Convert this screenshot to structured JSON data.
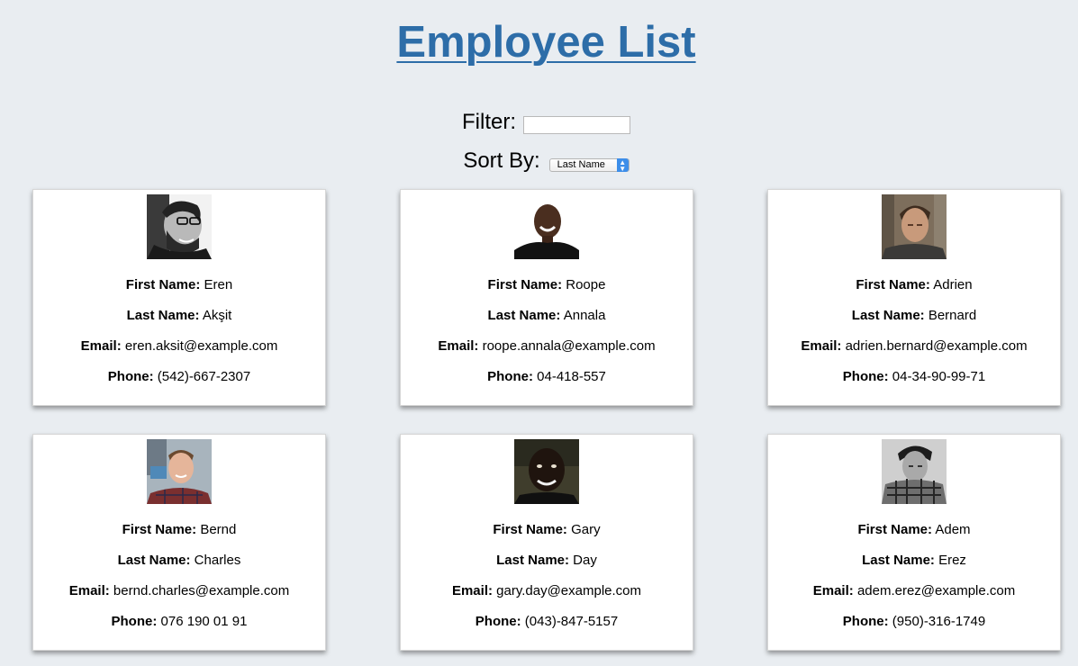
{
  "title": "Employee List",
  "filter": {
    "label": "Filter:",
    "value": "",
    "placeholder": ""
  },
  "sort": {
    "label": "Sort By:",
    "selected": "Last Name"
  },
  "field_labels": {
    "first": "First Name:",
    "last": "Last Name:",
    "email": "Email:",
    "phone": "Phone:"
  },
  "employees": [
    {
      "first": "Eren",
      "last": "Akşit",
      "email": "eren.aksit@example.com",
      "phone": "(542)-667-2307"
    },
    {
      "first": "Roope",
      "last": "Annala",
      "email": "roope.annala@example.com",
      "phone": "04-418-557"
    },
    {
      "first": "Adrien",
      "last": "Bernard",
      "email": "adrien.bernard@example.com",
      "phone": "04-34-90-99-71"
    },
    {
      "first": "Bernd",
      "last": "Charles",
      "email": "bernd.charles@example.com",
      "phone": "076 190 01 91"
    },
    {
      "first": "Gary",
      "last": "Day",
      "email": "gary.day@example.com",
      "phone": "(043)-847-5157"
    },
    {
      "first": "Adem",
      "last": "Erez",
      "email": "adem.erez@example.com",
      "phone": "(950)-316-1749"
    }
  ]
}
